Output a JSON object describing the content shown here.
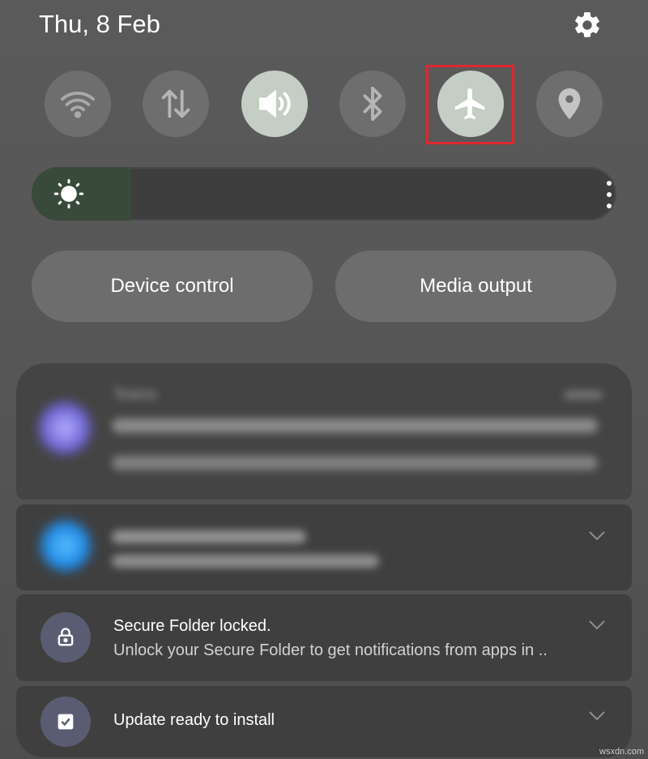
{
  "status": {
    "date": "Thu, 8 Feb"
  },
  "quick_tiles": [
    {
      "name": "Wi-Fi",
      "icon": "wifi-icon",
      "active": false
    },
    {
      "name": "Mobile data",
      "icon": "data-arrows-icon",
      "active": false
    },
    {
      "name": "Sound",
      "icon": "volume-icon",
      "active": true
    },
    {
      "name": "Bluetooth",
      "icon": "bluetooth-icon",
      "active": false
    },
    {
      "name": "Airplane mode",
      "icon": "airplane-icon",
      "active": true,
      "highlighted": true
    },
    {
      "name": "Location",
      "icon": "location-pin-icon",
      "active": false
    }
  ],
  "brightness": {
    "level": 0.17
  },
  "buttons": {
    "device_control": "Device control",
    "media_output": "Media output"
  },
  "notifications": [
    {
      "app": "Teams",
      "blurred": true
    },
    {
      "app": "",
      "blurred": true
    },
    {
      "title": "Secure Folder locked.",
      "body": "Unlock your Secure Folder to get notifications from apps in ..",
      "icon": "lock-icon"
    },
    {
      "title": "Update ready to install",
      "icon": "checkbox-icon"
    }
  ],
  "watermark": "wsxdn.com",
  "colors": {
    "tile_active": "#c4cec4",
    "tile_inactive": "#6e6e6e",
    "highlight": "#e0262e"
  }
}
